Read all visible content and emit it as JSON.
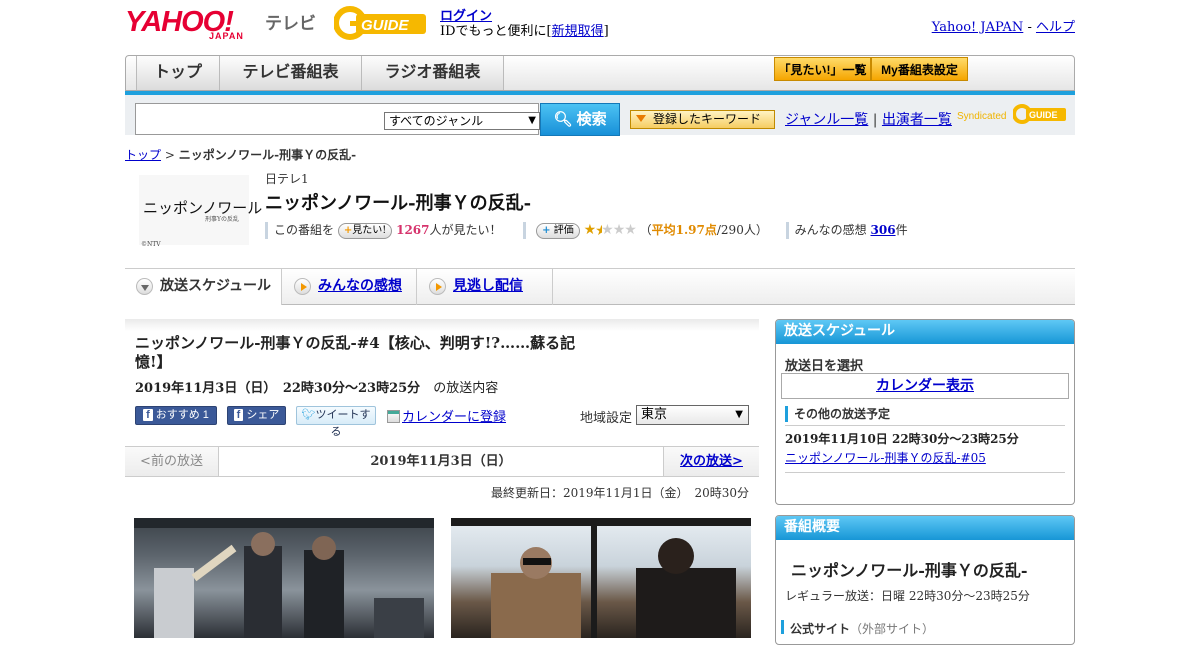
{
  "header": {
    "logo_yahoo": "YAHOO!",
    "logo_japan": "JAPAN",
    "logo_tv": "テレビ",
    "gguide": "G-GUIDE",
    "login": "ログイン",
    "id_text_prefix": "IDでもっと便利に[",
    "signup": "新規取得",
    "id_text_suffix": "]",
    "yahoo_japan": "Yahoo! JAPAN",
    "sep": " - ",
    "help": "ヘルプ"
  },
  "nav": {
    "tabs": [
      "トップ",
      "テレビ番組表",
      "ラジオ番組表"
    ],
    "mitai_list": "「見たい!」一覧",
    "my_schedule": "My番組表設定"
  },
  "search": {
    "genre": "すべてのジャンル",
    "search_button": "検索",
    "keyword_button": "登録したキーワード",
    "genre_list": "ジャンル一覧",
    "divider": "|",
    "cast_list": "出演者一覧",
    "syndicated": "Syndicated"
  },
  "breadcrumb": {
    "top": "トップ",
    "sep": " > ",
    "current": "ニッポンノワール-刑事Ｙの反乱-"
  },
  "program": {
    "thumb_title": "ニッポンノワール",
    "thumb_sub": "刑事Yの反乱",
    "thumb_ntv": "©NTV",
    "channel": "日テレ1",
    "title": "ニッポンノワール-刑事Ｙの反乱-",
    "want_prefix": "この番組を",
    "want_button": "見たい!",
    "want_count": "1267",
    "want_suffix": "人が見たい！",
    "rate_button": "評価",
    "rating_value": 1.97,
    "avg_open": "（",
    "avg_label": "平均1.97点",
    "avg_count": "/290人）",
    "reviews_prefix": "みんなの感想",
    "reviews_count": "306",
    "reviews_suffix": "件"
  },
  "tabs": {
    "schedule": "放送スケジュール",
    "reviews": "みんなの感想",
    "streaming": "見逃し配信"
  },
  "episode": {
    "title": "ニッポンノワール-刑事Ｙの反乱-#4【核心、判明す!?……蘇る記憶!】",
    "date": "2019年11月3日（日）　22時30分～23時25分",
    "date_suffix": "の放送内容",
    "fb_recommend": "おすすめ 1",
    "fb_share": "シェア",
    "tweet": "ツイートする",
    "calendar_register": "カレンダーに登録",
    "region_label": "地域設定",
    "region_value": "東京",
    "prev": "<前の放送",
    "current_date": "2019年11月3日（日）",
    "next": "次の放送>",
    "updated": "最終更新日：2019年11月1日（金）　20時30分"
  },
  "sidebar": {
    "schedule_head": "放送スケジュール",
    "select_date": "放送日を選択",
    "calendar_view": "カレンダー表示",
    "other_schedule": "その他の放送予定",
    "other_date": "2019年11月10日  22時30分～23時25分",
    "other_link": "ニッポンノワール-刑事Ｙの反乱-#05",
    "overview_head": "番組概要",
    "overview_title": "ニッポンノワール-刑事Ｙの反乱-",
    "regular": "レギュラー放送：日曜 22時30分～23時25分",
    "official_site": "公式サイト",
    "external": "（外部サイト）"
  },
  "colors": {
    "brand_red": "#e60033",
    "accent_blue": "#1ea0dd",
    "orange": "#f39800",
    "link": "#0000cc"
  }
}
